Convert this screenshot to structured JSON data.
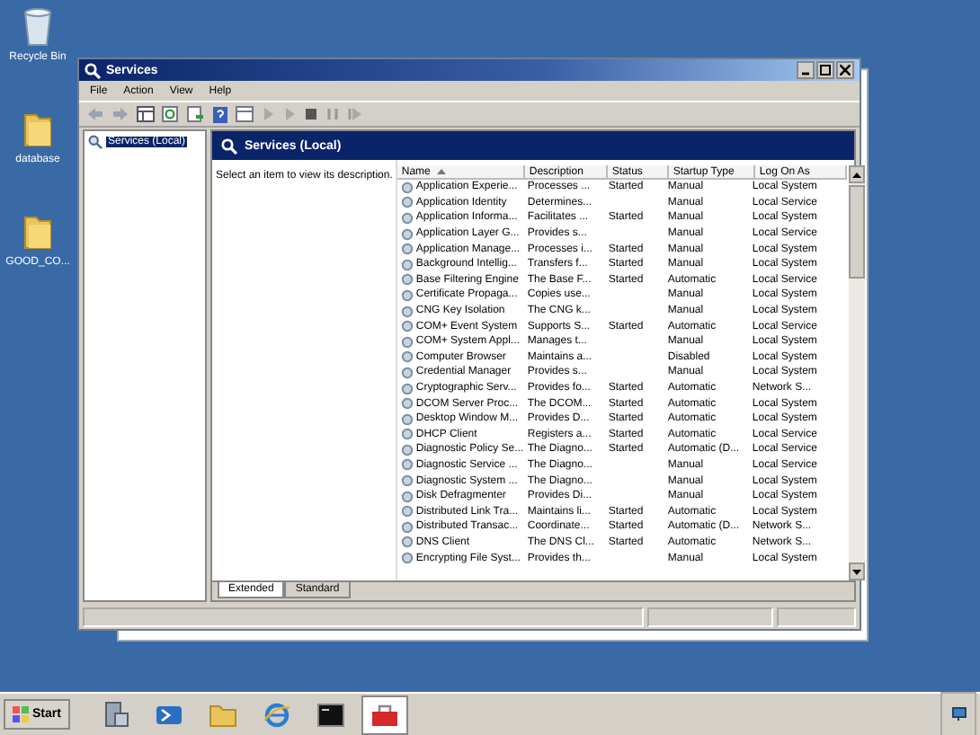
{
  "desktop_icons": [
    {
      "label": "Recycle Bin",
      "kind": "bin"
    },
    {
      "label": "database",
      "kind": "folder"
    },
    {
      "label": "GOOD_CO...",
      "kind": "folder"
    }
  ],
  "window": {
    "title": "Services",
    "menu": [
      "File",
      "Action",
      "View",
      "Help"
    ]
  },
  "tree": [
    {
      "label": "Services (Local)",
      "selected": true
    }
  ],
  "panel": {
    "title": "Services (Local)",
    "description": "Select an item to view its description."
  },
  "table": {
    "columns": [
      "Name",
      "Description",
      "Status",
      "Startup Type",
      "Log On As"
    ],
    "rows": [
      [
        "Application Experie...",
        "Processes ...",
        "Started",
        "Manual",
        "Local System"
      ],
      [
        "Application Identity",
        "Determines...",
        "",
        "Manual",
        "Local Service"
      ],
      [
        "Application Informa...",
        "Facilitates ...",
        "Started",
        "Manual",
        "Local System"
      ],
      [
        "Application Layer G...",
        "Provides s...",
        "",
        "Manual",
        "Local Service"
      ],
      [
        "Application Manage...",
        "Processes i...",
        "Started",
        "Manual",
        "Local System"
      ],
      [
        "Background Intellig...",
        "Transfers f...",
        "Started",
        "Manual",
        "Local System"
      ],
      [
        "Base Filtering Engine",
        "The Base F...",
        "Started",
        "Automatic",
        "Local Service"
      ],
      [
        "Certificate Propaga...",
        "Copies use...",
        "",
        "Manual",
        "Local System"
      ],
      [
        "CNG Key Isolation",
        "The CNG k...",
        "",
        "Manual",
        "Local System"
      ],
      [
        "COM+ Event System",
        "Supports S...",
        "Started",
        "Automatic",
        "Local Service"
      ],
      [
        "COM+ System Appl...",
        "Manages t...",
        "",
        "Manual",
        "Local System"
      ],
      [
        "Computer Browser",
        "Maintains a...",
        "",
        "Disabled",
        "Local System"
      ],
      [
        "Credential Manager",
        "Provides s...",
        "",
        "Manual",
        "Local System"
      ],
      [
        "Cryptographic Serv...",
        "Provides fo...",
        "Started",
        "Automatic",
        "Network S..."
      ],
      [
        "DCOM Server Proc...",
        "The DCOM...",
        "Started",
        "Automatic",
        "Local System"
      ],
      [
        "Desktop Window M...",
        "Provides D...",
        "Started",
        "Automatic",
        "Local System"
      ],
      [
        "DHCP Client",
        "Registers a...",
        "Started",
        "Automatic",
        "Local Service"
      ],
      [
        "Diagnostic Policy Se...",
        "The Diagno...",
        "Started",
        "Automatic (D...",
        "Local Service"
      ],
      [
        "Diagnostic Service ...",
        "The Diagno...",
        "",
        "Manual",
        "Local Service"
      ],
      [
        "Diagnostic System ...",
        "The Diagno...",
        "",
        "Manual",
        "Local System"
      ],
      [
        "Disk Defragmenter",
        "Provides Di...",
        "",
        "Manual",
        "Local System"
      ],
      [
        "Distributed Link Tra...",
        "Maintains li...",
        "Started",
        "Automatic",
        "Local System"
      ],
      [
        "Distributed Transac...",
        "Coordinate...",
        "Started",
        "Automatic (D...",
        "Network S..."
      ],
      [
        "DNS Client",
        "The DNS Cl...",
        "Started",
        "Automatic",
        "Network S..."
      ],
      [
        "Encrypting File Syst...",
        "Provides th...",
        "",
        "Manual",
        "Local System"
      ]
    ]
  },
  "view_tabs": [
    {
      "label": "Extended",
      "selected": true
    },
    {
      "label": "Standard",
      "selected": false
    }
  ],
  "taskbar": {
    "start": "Start",
    "items": [
      {
        "kind": "server",
        "selected": false
      },
      {
        "kind": "shell",
        "selected": false
      },
      {
        "kind": "explorer",
        "selected": false
      },
      {
        "kind": "browser",
        "selected": false
      },
      {
        "kind": "console",
        "selected": false
      },
      {
        "kind": "toolbox",
        "selected": true
      }
    ]
  }
}
